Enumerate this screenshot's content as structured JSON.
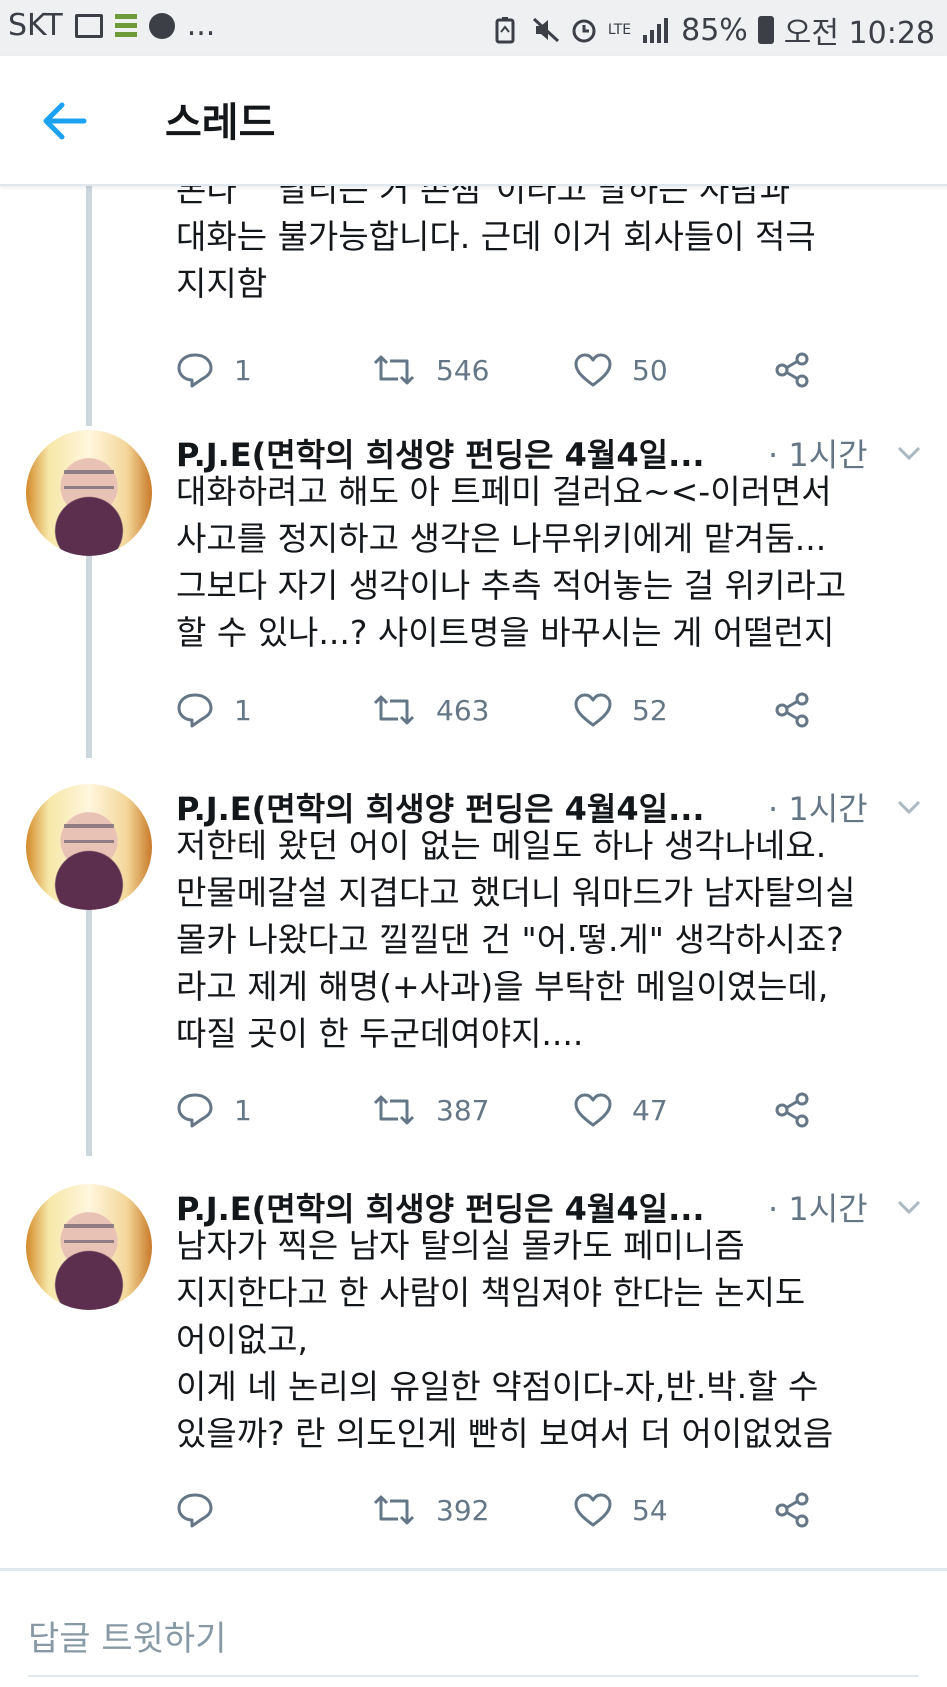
{
  "status_bar": {
    "carrier": "SKT",
    "more": "...",
    "network": "LTE",
    "battery": "85%",
    "time": "오전 10:28",
    "icons": [
      "gallery-icon",
      "app-list-icon",
      "avatar-notification-icon",
      "battery-saver-icon",
      "mute-icon",
      "alarm-icon",
      "lte-icon",
      "signal-icon",
      "battery-icon"
    ]
  },
  "header": {
    "title": "스레드",
    "back_icon": "arrow-left-icon"
  },
  "colors": {
    "accent": "#1da1f2",
    "text": "#14171a",
    "muted": "#657786",
    "divider": "#e1e8ed"
  },
  "tweets": [
    {
      "partial": true,
      "text": "본다\" \"달리는 거 존잼\"이라고 말하는 사람과\n대화는 불가능합니다. 근데 이거 회사들이 적극\n지지함",
      "replies": "1",
      "retweets": "546",
      "likes": "50"
    },
    {
      "author": "P.J.E(면학의 희생양 펀딩은 4월4일...",
      "time": "· 1시간",
      "text": "대화하려고 해도 아 트페미 걸러요~<-이러면서\n사고를 정지하고 생각은 나무위키에게 맡겨둠...\n그보다 자기 생각이나 추측 적어놓는 걸 위키라고\n할 수 있나...? 사이트명을 바꾸시는 게 어떨런지",
      "replies": "1",
      "retweets": "463",
      "likes": "52"
    },
    {
      "author": "P.J.E(면학의 희생양 펀딩은 4월4일...",
      "time": "· 1시간",
      "text": "저한테 왔던 어이 없는 메일도 하나 생각나네요.\n만물메갈설 지겹다고 했더니 워마드가 남자탈의실\n몰카 나왔다고 낄낄댄 건 \"어.떻.게\" 생각하시죠?\n라고 제게 해명(+사과)을 부탁한 메일이였는데,\n따질 곳이 한 두군데여야지....",
      "replies": "1",
      "retweets": "387",
      "likes": "47"
    },
    {
      "author": "P.J.E(면학의 희생양 펀딩은 4월4일...",
      "time": "· 1시간",
      "text": "남자가 찍은 남자 탈의실 몰카도 페미니즘\n지지한다고 한 사람이 책임져야 한다는 논지도\n어이없고,\n이게 네 논리의 유일한 약점이다-자,반.박.할 수\n있을까? 란 의도인게 빤히 보여서 더 어이없었음",
      "replies": "",
      "retweets": "392",
      "likes": "54"
    }
  ],
  "reply_bar": {
    "placeholder": "답글 트윗하기"
  }
}
